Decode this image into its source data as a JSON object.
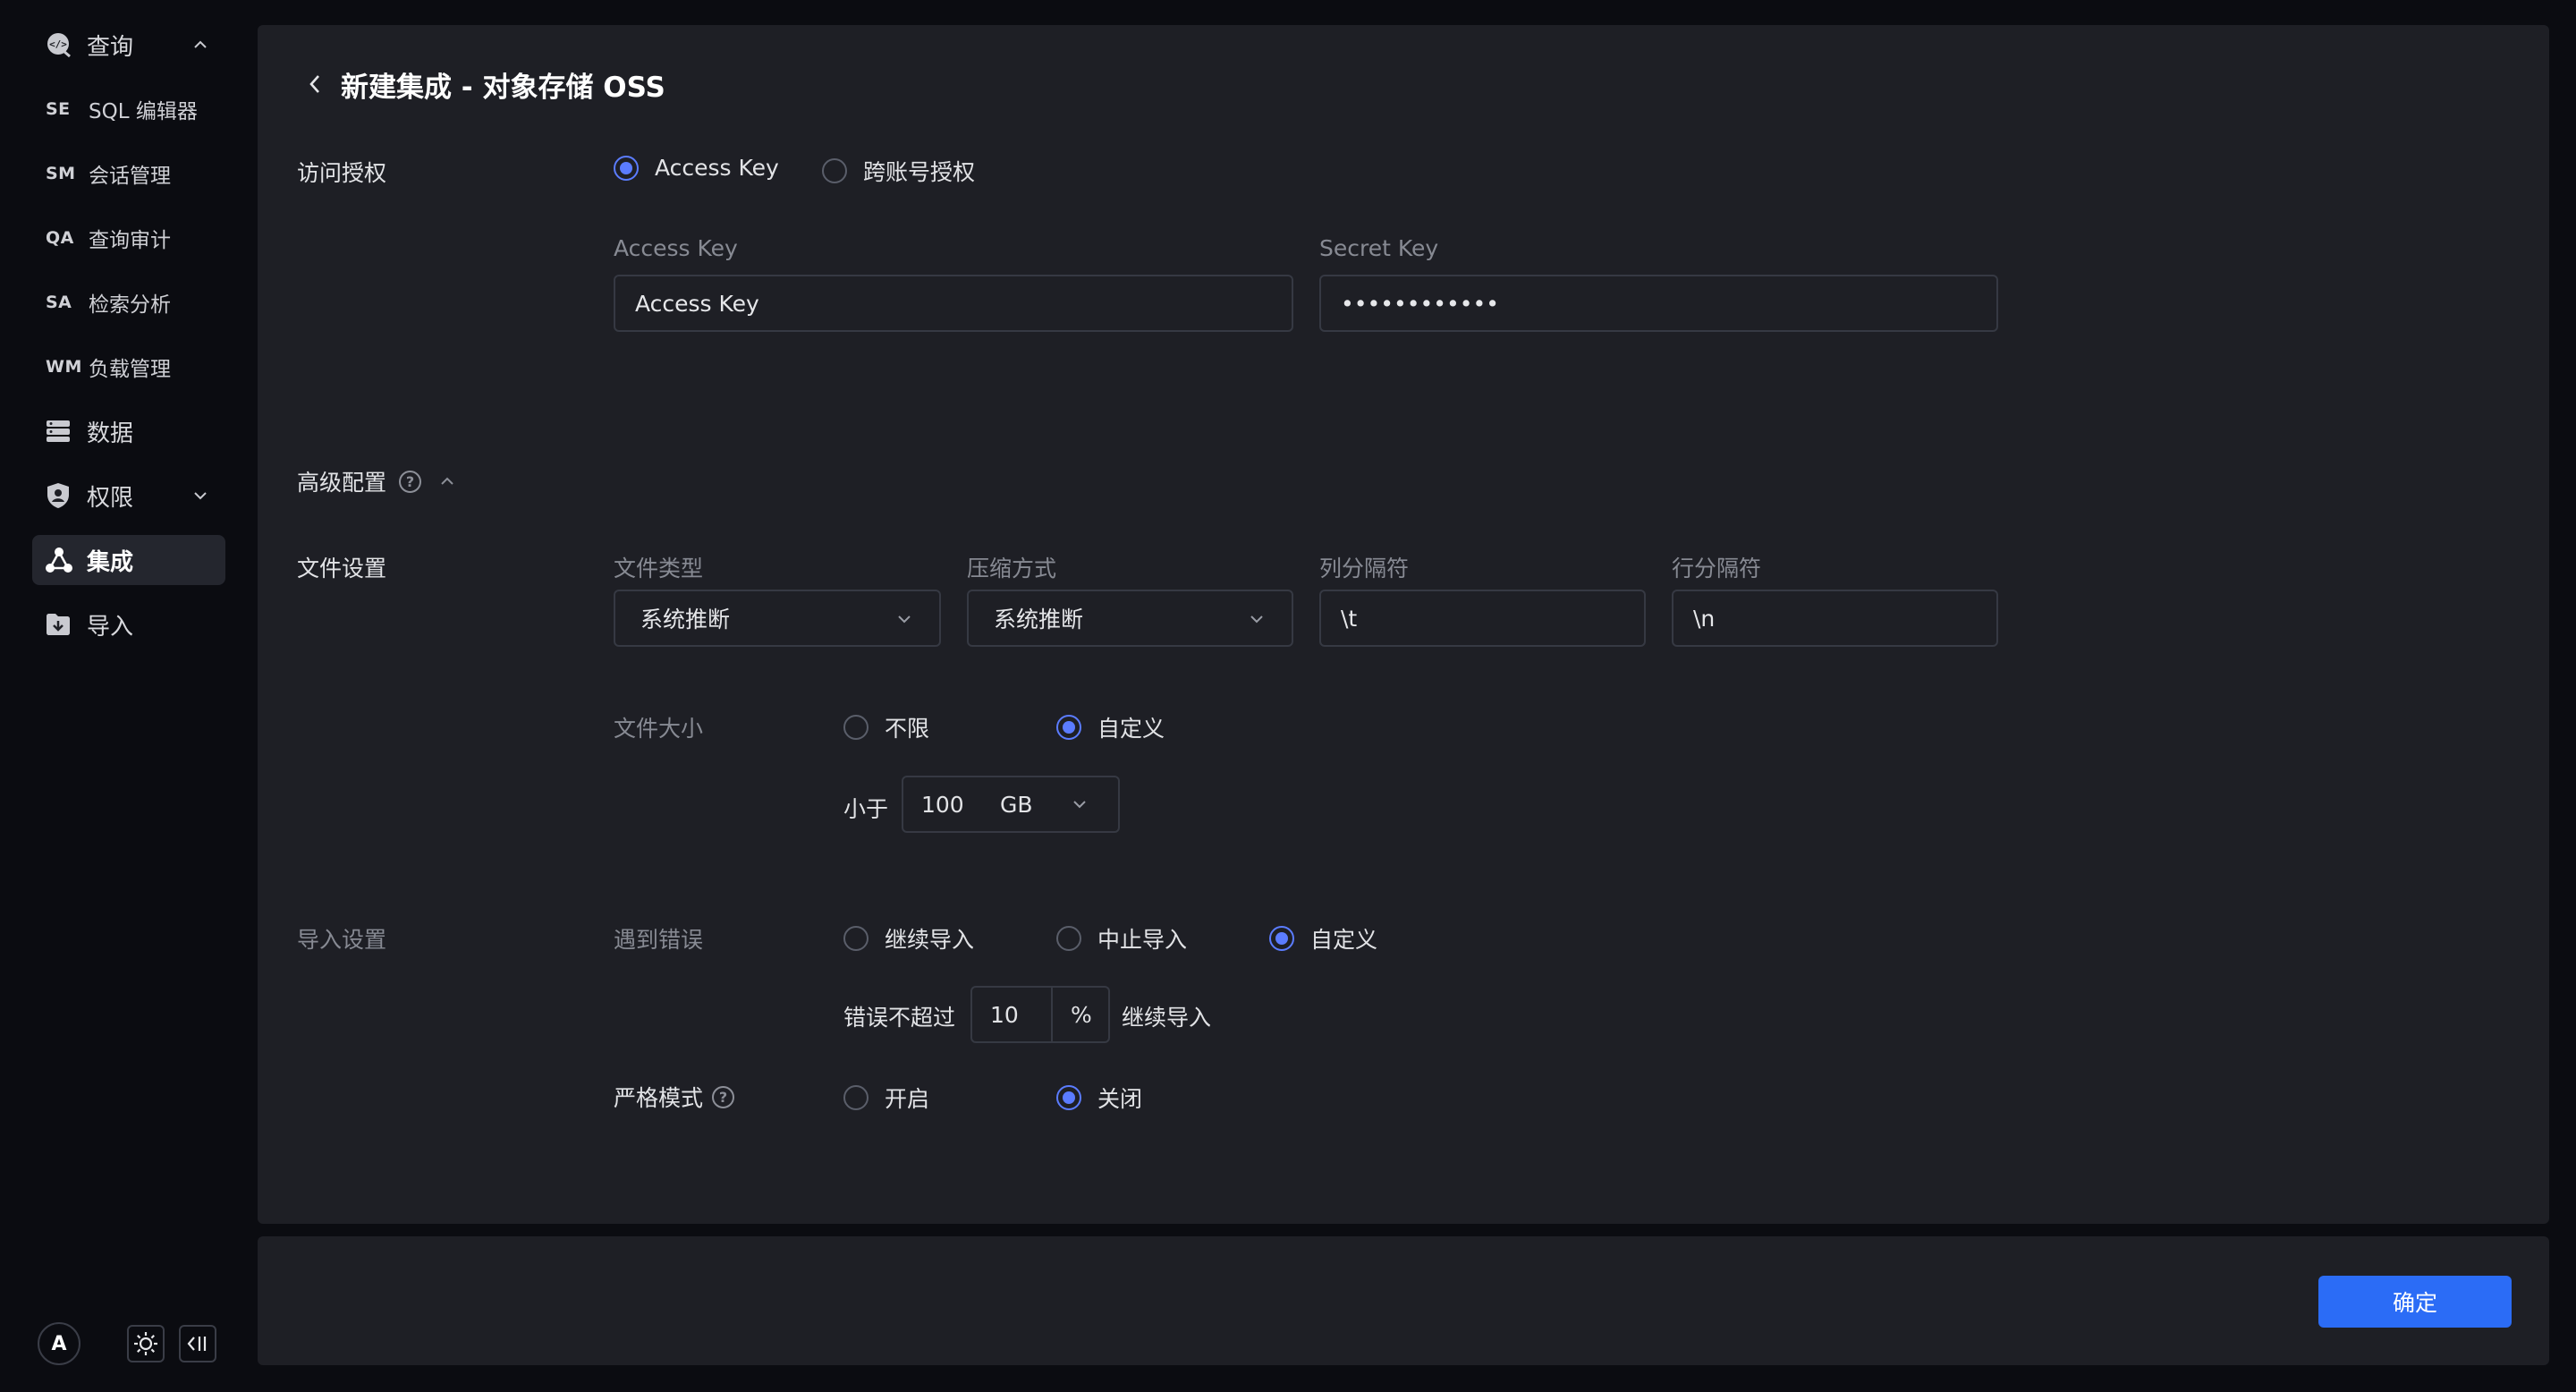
{
  "sidebar": {
    "items": [
      {
        "icon": "query-icon",
        "label": "查询",
        "expanded": true
      },
      {
        "abbr": "SE",
        "label": "SQL 编辑器"
      },
      {
        "abbr": "SM",
        "label": "会话管理"
      },
      {
        "abbr": "QA",
        "label": "查询审计"
      },
      {
        "abbr": "SA",
        "label": "检索分析"
      },
      {
        "abbr": "WM",
        "label": "负载管理"
      },
      {
        "icon": "database-icon",
        "label": "数据"
      },
      {
        "icon": "permission-icon",
        "label": "权限",
        "expanded": false
      },
      {
        "icon": "integration-icon",
        "label": "集成",
        "active": true
      },
      {
        "icon": "import-icon",
        "label": "导入"
      }
    ],
    "avatar_letter": "A"
  },
  "header": {
    "title": "新建集成 - 对象存储 OSS"
  },
  "auth": {
    "label": "访问授权",
    "options": [
      "Access Key",
      "跨账号授权"
    ],
    "selected": "Access Key",
    "access_key_label": "Access Key",
    "access_key_value": "Access Key",
    "secret_key_label": "Secret Key",
    "secret_key_value": "••••••••••••"
  },
  "advanced": {
    "label": "高级配置"
  },
  "file_settings": {
    "label": "文件设置",
    "file_type_label": "文件类型",
    "file_type_value": "系统推断",
    "compression_label": "压缩方式",
    "compression_value": "系统推断",
    "column_sep_label": "列分隔符",
    "column_sep_value": "\\t",
    "row_sep_label": "行分隔符",
    "row_sep_value": "\\n",
    "file_size_label": "文件大小",
    "file_size_options": [
      "不限",
      "自定义"
    ],
    "file_size_selected": "自定义",
    "less_than_label": "小于",
    "size_value": "100",
    "size_unit": "GB"
  },
  "import_settings": {
    "label": "导入设置",
    "on_error_label": "遇到错误",
    "on_error_options": [
      "继续导入",
      "中止导入",
      "自定义"
    ],
    "on_error_selected": "自定义",
    "error_prefix": "错误不超过",
    "error_value": "10",
    "error_unit": "%",
    "error_suffix": "继续导入",
    "strict_label": "严格模式",
    "strict_options": [
      "开启",
      "关闭"
    ],
    "strict_selected": "关闭"
  },
  "footer": {
    "confirm_label": "确定"
  },
  "colors": {
    "accent": "#5b7cff",
    "primary_button": "#2b6cf6",
    "panel": "#1e1f25",
    "background": "#0b0c11"
  }
}
